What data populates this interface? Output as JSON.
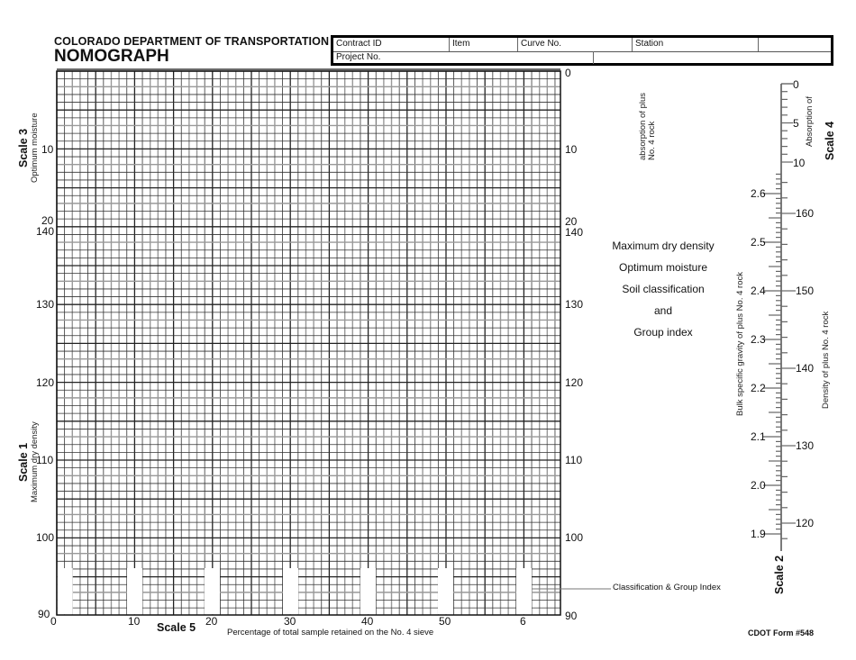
{
  "header": {
    "organization": "COLORADO DEPARTMENT OF TRANSPORTATION",
    "title": "NOMOGRAPH",
    "form_fields": {
      "row1": [
        {
          "label": "Contract ID",
          "value": ""
        },
        {
          "label": "Item",
          "value": ""
        },
        {
          "label": "Curve No.",
          "value": ""
        },
        {
          "label": "Station",
          "value": ""
        },
        {
          "label": "",
          "value": ""
        }
      ],
      "row2": [
        {
          "label": "Project No.",
          "value": ""
        },
        {
          "label": "",
          "value": ""
        }
      ]
    }
  },
  "scale3": {
    "title": "Scale 3",
    "subtitle": "Optimum moisture",
    "ticks": [
      "0",
      "10",
      "20"
    ]
  },
  "scale1": {
    "title": "Scale 1",
    "subtitle": "Maximum dry density",
    "ticks": [
      "140",
      "130",
      "120",
      "110",
      "100",
      "90"
    ]
  },
  "scale5": {
    "title": "Scale 5",
    "subtitle": "Percentage of total sample retained on the No. 4 sieve",
    "ticks": [
      "0",
      "10",
      "20",
      "30",
      "40",
      "50",
      "6"
    ]
  },
  "right_axis": {
    "moisture_ticks": [
      "0",
      "10",
      "20"
    ],
    "density_ticks": [
      "140",
      "130",
      "120",
      "110",
      "100",
      "90"
    ]
  },
  "center_labels": {
    "absorption_note": "absorption of plus No. 4 rock",
    "results": [
      "Maximum dry density",
      "Optimum moisture",
      "Soil classification",
      "and",
      "Group index"
    ],
    "classification_label": "Classification & Group Index"
  },
  "scale4": {
    "title": "Scale 4",
    "subtitle": "Absorption of",
    "ticks": [
      "0",
      "5",
      "10"
    ]
  },
  "scale2": {
    "title": "Scale 2",
    "gravity_label": "Bulk specific gravity of plus No. 4 rock",
    "density_label": "Density of plus No. 4 rock",
    "gravity_ticks": [
      "2.6",
      "2.5",
      "2.4",
      "2.3",
      "2.2",
      "2.1",
      "2.0",
      "1.9"
    ],
    "density_ticks": [
      "160",
      "150",
      "140",
      "130",
      "120"
    ]
  },
  "footer": {
    "form_number": "CDOT Form #548"
  }
}
